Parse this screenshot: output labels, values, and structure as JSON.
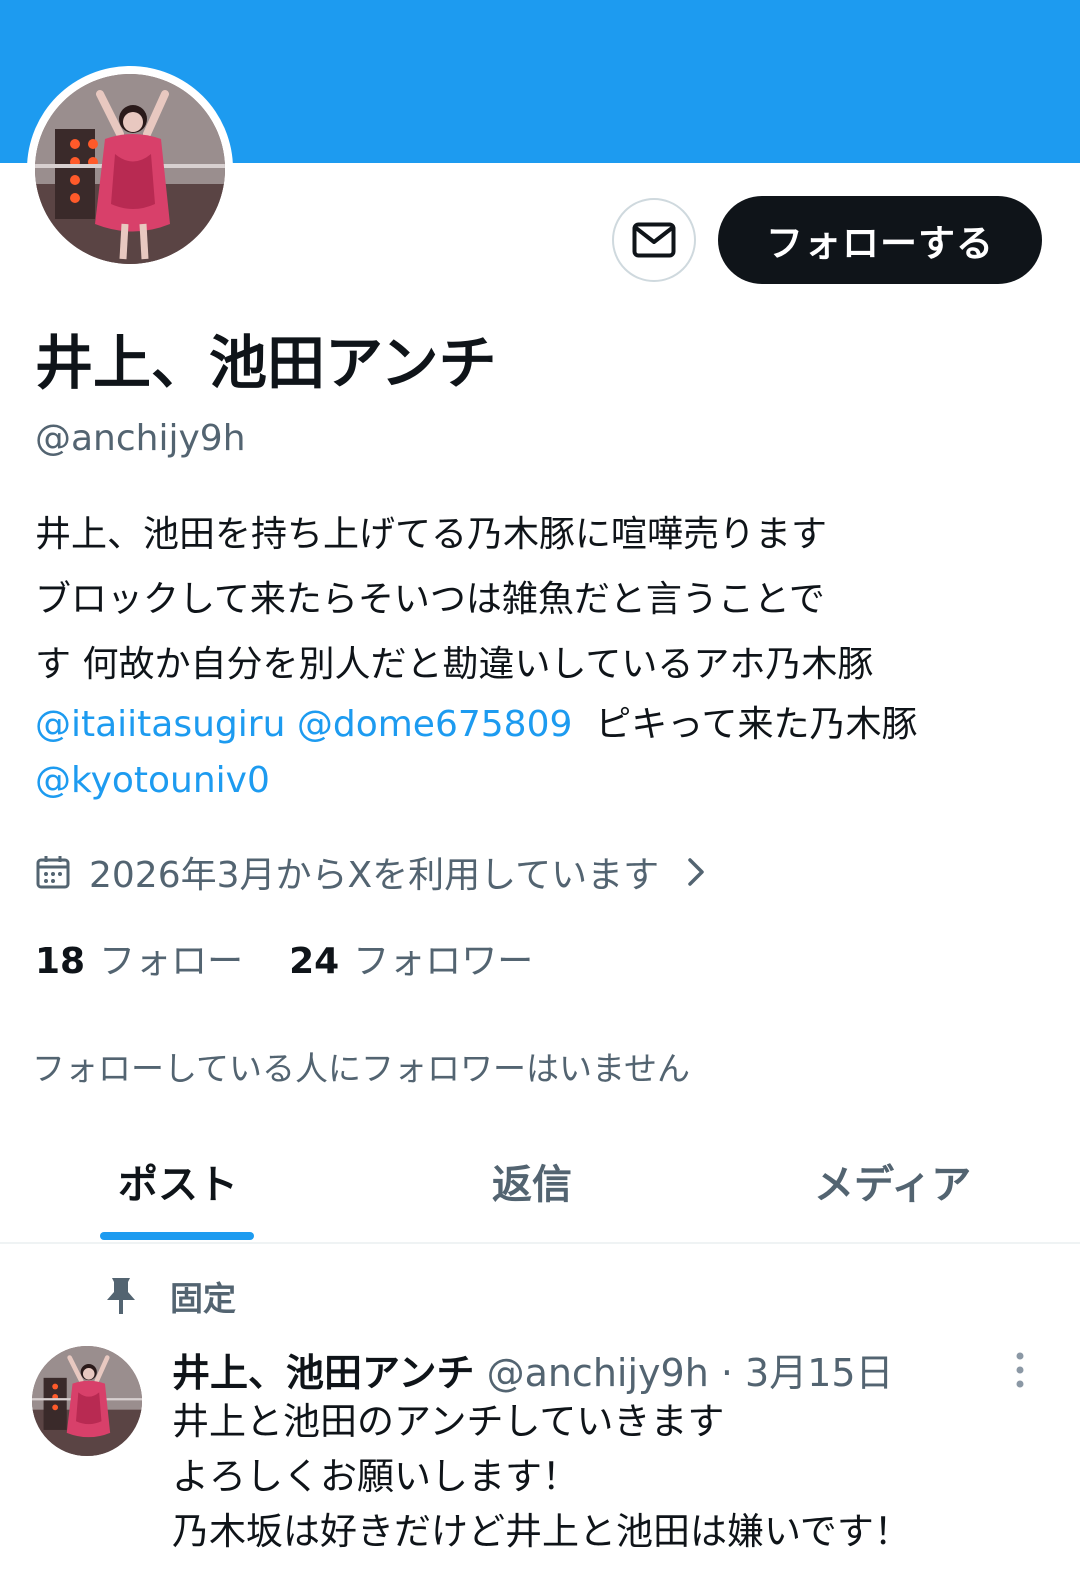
{
  "colors": {
    "banner": "#1d9bf0",
    "accent": "#1d9bf0",
    "text_primary": "#0f1419",
    "text_secondary": "#536471",
    "follow_button_bg": "#0f1419"
  },
  "profile": {
    "display_name": "井上、池田アンチ",
    "handle": "@anchijy9h",
    "follow_label": "フォローする",
    "message_icon": "envelope-icon",
    "avatar_image": "profile-photo"
  },
  "bio": {
    "line1": "井上、池田を持ち上げてる乃木豚に喧嘩売ります",
    "line2": "ブロックして来たらそいつは雑魚だと言うことで",
    "line3": "す 何故か自分を別人だと勘違いしているアホ乃木豚",
    "mention1": "@itaiitasugiru",
    "mention2": "@dome675809",
    "after_mentions": "ピキって来た乃木豚",
    "mention3": "@kyotouniv0"
  },
  "joined": {
    "icon": "calendar-icon",
    "text": "2026年3月からXを利用しています",
    "chevron": "chevron-right-icon"
  },
  "stats": {
    "following_count": "18",
    "following_label": "フォロー",
    "followers_count": "24",
    "followers_label": "フォロワー"
  },
  "mutual_note": "フォローしている人にフォロワーはいません",
  "tabs": [
    {
      "label": "ポスト",
      "active": true
    },
    {
      "label": "返信",
      "active": false
    },
    {
      "label": "メディア",
      "active": false
    }
  ],
  "post": {
    "pinned_label": "固定",
    "pin_icon": "pin-icon",
    "name": "井上、池田アンチ",
    "meta": " @anchijy9h · 3月15日",
    "more_icon": "more-vertical-icon",
    "lines": [
      "井上と池田のアンチしていきます",
      "よろしくお願いします！",
      "乃木坂は好きだけど井上と池田は嫌いです！"
    ]
  }
}
